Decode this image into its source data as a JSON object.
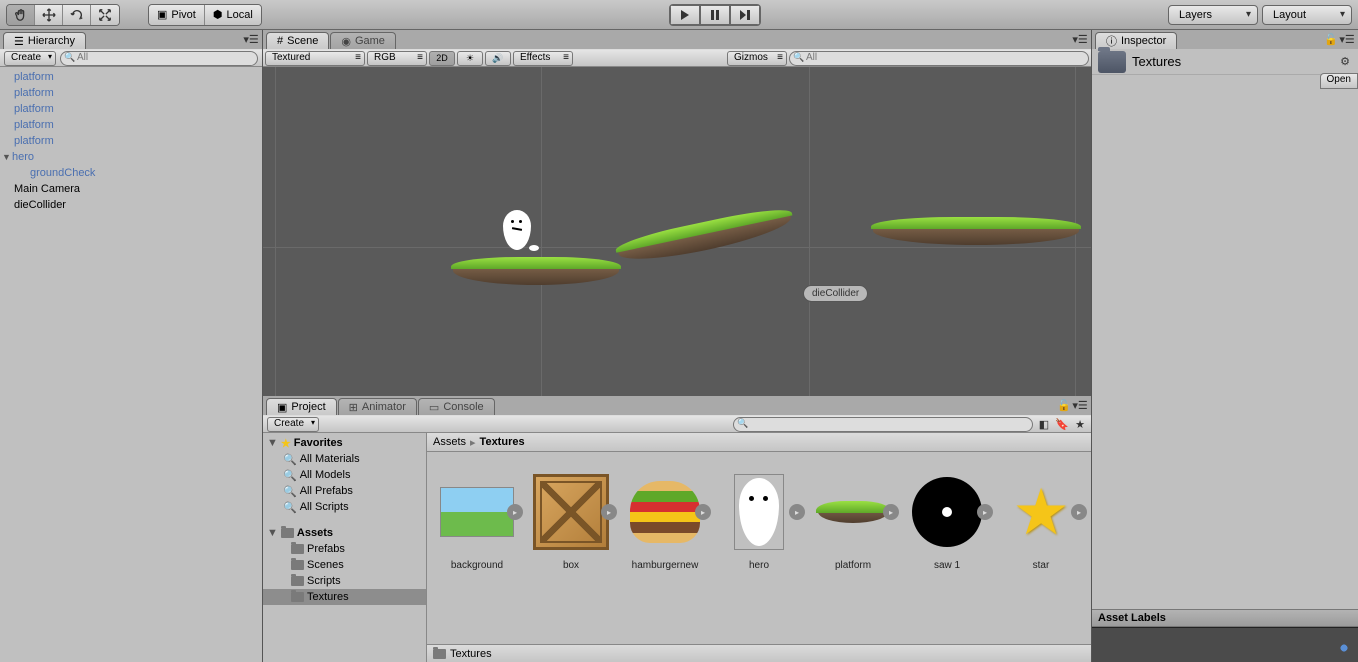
{
  "toolbar": {
    "pivot": "Pivot",
    "local": "Local",
    "layers": "Layers",
    "layout": "Layout"
  },
  "hierarchy": {
    "tab": "Hierarchy",
    "create": "Create",
    "search_placeholder": "All",
    "items": [
      {
        "label": "platform",
        "cls": "h-item"
      },
      {
        "label": "platform",
        "cls": "h-item"
      },
      {
        "label": "platform",
        "cls": "h-item"
      },
      {
        "label": "platform",
        "cls": "h-item"
      },
      {
        "label": "platform",
        "cls": "h-item"
      },
      {
        "label": "hero",
        "cls": "h-item",
        "caret": "▼"
      },
      {
        "label": "groundCheck",
        "cls": "h-item child"
      },
      {
        "label": "Main Camera",
        "cls": "h-item black"
      },
      {
        "label": "dieCollider",
        "cls": "h-item black"
      }
    ]
  },
  "scene": {
    "tabs": {
      "scene": "Scene",
      "game": "Game"
    },
    "shading": "Textured",
    "rgb": "RGB",
    "twod": "2D",
    "effects": "Effects",
    "gizmos": "Gizmos",
    "search_placeholder": "All",
    "collider_label": "dieCollider"
  },
  "project": {
    "tabs": {
      "project": "Project",
      "animator": "Animator",
      "console": "Console"
    },
    "create": "Create",
    "favorites_label": "Favorites",
    "favorites": [
      "All Materials",
      "All Models",
      "All Prefabs",
      "All Scripts"
    ],
    "assets_label": "Assets",
    "folders": [
      "Prefabs",
      "Scenes",
      "Scripts",
      "Textures"
    ],
    "selected_folder": "Textures",
    "breadcrumb": {
      "root": "Assets",
      "current": "Textures"
    },
    "assets": [
      {
        "name": "background",
        "type": "bg"
      },
      {
        "name": "box",
        "type": "box"
      },
      {
        "name": "hamburgernew",
        "type": "burger"
      },
      {
        "name": "hero",
        "type": "hero"
      },
      {
        "name": "platform",
        "type": "platform"
      },
      {
        "name": "saw 1",
        "type": "saw"
      },
      {
        "name": "star",
        "type": "star"
      }
    ],
    "footer": "Textures"
  },
  "inspector": {
    "tab": "Inspector",
    "title": "Textures",
    "open": "Open",
    "asset_labels": "Asset Labels"
  }
}
